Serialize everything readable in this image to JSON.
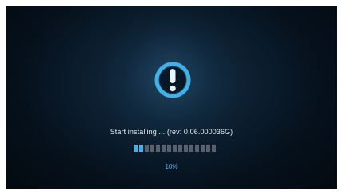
{
  "status": {
    "message": "Start installing ... (rev: 0.06.000036G)",
    "progress_percent": 10,
    "progress_label": "10%",
    "segments_total": 15,
    "segments_filled": 2
  },
  "icon": {
    "name": "exclamation-icon",
    "color": "#3fb2ea"
  },
  "colors": {
    "accent": "#3fb2ea",
    "segment_empty": "#596069",
    "text": "#e6edf2"
  }
}
